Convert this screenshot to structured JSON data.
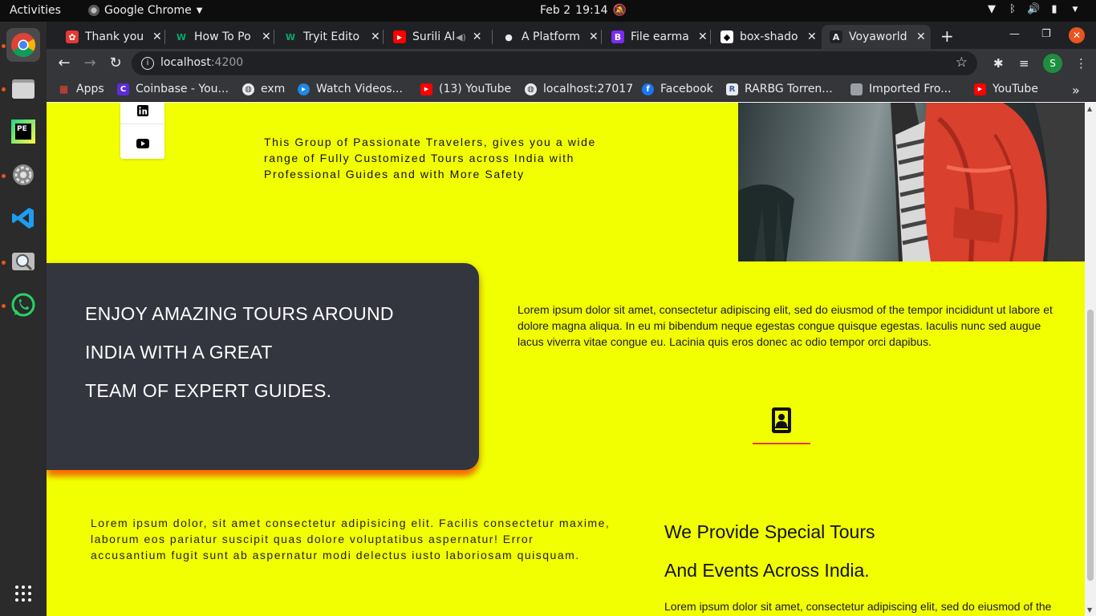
{
  "os": {
    "activities": "Activities",
    "app_menu": "Google Chrome",
    "date": "Feb 2",
    "time": "19:14"
  },
  "dock": {
    "items": [
      "chrome",
      "files",
      "pycharm",
      "settings",
      "vscode",
      "screenshot",
      "whatsapp",
      "show-apps"
    ]
  },
  "browser": {
    "tabs": [
      {
        "title": "Thank you",
        "favicon_color": "#e53935",
        "favicon_char": "✿"
      },
      {
        "title": "How To Po",
        "favicon_color": "#202124",
        "favicon_char": "W"
      },
      {
        "title": "Tryit Edito",
        "favicon_color": "#202124",
        "favicon_char": "W"
      },
      {
        "title": "Surili Al",
        "favicon_color": "#ff0000",
        "favicon_char": "▶"
      },
      {
        "title": "A Platform",
        "favicon_color": "#202124",
        "favicon_char": "●"
      },
      {
        "title": "File earma",
        "favicon_color": "#7a2bf2",
        "favicon_char": "B"
      },
      {
        "title": "box-shado",
        "favicon_color": "#ffffff",
        "favicon_char": "◆"
      },
      {
        "title": "Voyaworld",
        "favicon_color": "#202124",
        "favicon_char": "A"
      }
    ],
    "url_host": "localhost",
    "url_port": ":4200",
    "profile_initial": "S",
    "bookmarks": [
      {
        "label": "Apps",
        "color": "#4285f4",
        "char": "⋮"
      },
      {
        "label": "Coinbase - You...",
        "color": "#5b2cdb",
        "char": "C"
      },
      {
        "label": "exm",
        "color": "#5f6368",
        "char": "🌐"
      },
      {
        "label": "Watch Videos...",
        "color": "#1e88e5",
        "char": "▸"
      },
      {
        "label": "(13) YouTube",
        "color": "#ff0000",
        "char": "▶"
      },
      {
        "label": "localhost:27017",
        "color": "#5f6368",
        "char": "🌐"
      },
      {
        "label": "Facebook",
        "color": "#1877f2",
        "char": "f"
      },
      {
        "label": "RARBG Torren...",
        "color": "#3b5ba9",
        "char": "R"
      },
      {
        "label": "Imported Fro...",
        "color": "#9aa0a6",
        "char": "▬"
      },
      {
        "label": "YouTube",
        "color": "#ff0000",
        "char": "▶"
      }
    ]
  },
  "page": {
    "intro": "This Group of Passionate Travelers, gives you a wide range of Fully Customized Tours across India with Professional Guides and with More Safety",
    "hero_lines": [
      "ENJOY AMAZING TOURS AROUND",
      "INDIA WITH A GREAT",
      "TEAM OF EXPERT GUIDES."
    ],
    "lorem_right": "Lorem ipsum dolor sit amet, consectetur adipiscing elit, sed do eiusmod of the tempor incididunt ut labore et dolore magna aliqua. In eu mi bibendum neque egestas congue quisque egestas. Iaculis nunc sed augue lacus viverra vitae congue eu. Lacinia quis eros donec ac odio tempor orci dapibus.",
    "lorem_left": "Lorem ipsum dolor, sit amet consectetur adipisicing elit. Facilis consectetur maxime, laborum eos pariatur suscipit quas dolore voluptatibus aspernatur! Error accusantium fugit sunt ab aspernatur modi delectus iusto laboriosam quisquam.",
    "special_title_1": "We Provide Special Tours",
    "special_title_2": "And Events Across India.",
    "lorem_bottom": "Lorem ipsum dolor sit amet, consectetur adipiscing elit, sed do eiusmod of the",
    "colors": {
      "page_bg": "#f2ff00",
      "card_bg": "#33363f",
      "card_glow": "#ff6a00",
      "accent_underline": "#e53935"
    }
  }
}
